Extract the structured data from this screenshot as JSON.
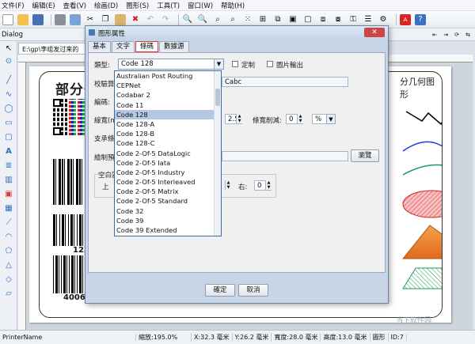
{
  "menu": [
    "文件(F)",
    "编辑(E)",
    "查看(V)",
    "绘画(D)",
    "图形(S)",
    "工具(T)",
    "窗口(W)",
    "帮助(H)"
  ],
  "dialog_bar": "Dialog",
  "doc_tab": "E:\\gp\\李组发过来的",
  "canvas": {
    "big_text": "部分条",
    "barcode_num1": "1234",
    "barcode_num2": "4006",
    "geo_title": "分几何图形"
  },
  "dialog": {
    "title": "图形属性",
    "tabs": [
      "基本",
      "文字",
      "條碼",
      "數據源"
    ],
    "active_tab": "條碼",
    "type_label": "類型:",
    "type_value": "Code 128",
    "custom_label": "定制",
    "image_output_label": "圖片輸出",
    "verify_label": "校驗算",
    "verify_value": "Cabc",
    "encode_label": "編碼:",
    "line_width_label": "線寬(m",
    "line_width_value": "2.5",
    "ratio_label": "條寬削減:",
    "ratio_value": "0",
    "ratio_unit": "%",
    "support_label": "支承條",
    "draw_label": "繪制預",
    "browse_label": "瀏覽",
    "blank_label": "空白區",
    "top_label": "上",
    "right_label": "右:",
    "right_value": "0",
    "ok_label": "確定",
    "cancel_label": "取消",
    "barcode_types": [
      "Australian Post Routing",
      "CEPNet",
      "Codabar 2",
      "Code 11",
      "Code 128",
      "Code 128-A",
      "Code 128-B",
      "Code 128-C",
      "Code 2-Of-5 DataLogic",
      "Code 2-Of-5 Iata",
      "Code 2-Of-5 Industry",
      "Code 2-Of-5 Interleaved",
      "Code 2-Of-5 Matrix",
      "Code 2-Of-5 Standard",
      "Code 32",
      "Code 39",
      "Code 39 Extended"
    ],
    "selected_index": 4
  },
  "status": {
    "printer": "PrinterName",
    "zoom": "縮放:195.0%",
    "x": "X:32.3 毫米",
    "y": "Y:26.2 毫米",
    "width": "寬度:28.0 毫米",
    "height": "高度:13.0 毫米",
    "type": "圖形",
    "id": "ID:7"
  },
  "watermark": "当下软件园"
}
